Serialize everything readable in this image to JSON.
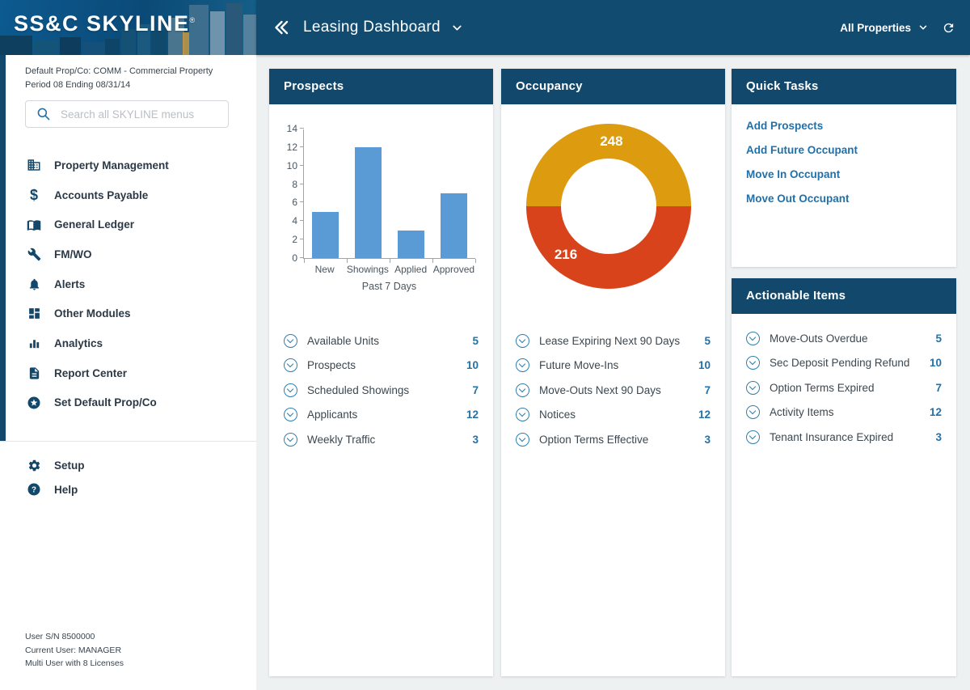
{
  "sidebar": {
    "logo_text": "SS&C SKYLINE",
    "logo_reg": "®",
    "default_prop_line1": "Default Prop/Co: COMM - Commercial Property",
    "default_prop_line2": "Period 08 Ending 08/31/14",
    "search_placeholder": "Search all SKYLINE menus",
    "menu": [
      {
        "label": "Property Management",
        "icon": "building-icon"
      },
      {
        "label": "Accounts Payable",
        "icon": "dollar-icon"
      },
      {
        "label": "General Ledger",
        "icon": "book-icon"
      },
      {
        "label": "FM/WO",
        "icon": "wrench-icon"
      },
      {
        "label": "Alerts",
        "icon": "bell-icon"
      },
      {
        "label": "Other Modules",
        "icon": "grid-icon"
      },
      {
        "label": "Analytics",
        "icon": "analytics-icon"
      },
      {
        "label": "Report Center",
        "icon": "report-icon"
      },
      {
        "label": "Set Default Prop/Co",
        "icon": "star-circle-icon"
      }
    ],
    "footer_menu": [
      {
        "label": "Setup",
        "icon": "gear-icon"
      },
      {
        "label": "Help",
        "icon": "question-icon"
      }
    ],
    "user_info": [
      "User S/N 8500000",
      "Current User: MANAGER",
      "Multi User with 8 Licenses"
    ]
  },
  "header": {
    "title": "Leasing Dashboard",
    "property_selector": "All Properties"
  },
  "cards": {
    "prospects": {
      "title": "Prospects",
      "list": [
        {
          "label": "Available Units",
          "count": "5"
        },
        {
          "label": "Prospects",
          "count": "10"
        },
        {
          "label": "Scheduled Showings",
          "count": "7"
        },
        {
          "label": "Applicants",
          "count": "12"
        },
        {
          "label": "Weekly Traffic",
          "count": "3"
        }
      ]
    },
    "occupancy": {
      "title": "Occupancy",
      "list": [
        {
          "label": "Lease Expiring Next 90 Days",
          "count": "5"
        },
        {
          "label": "Future Move-Ins",
          "count": "10"
        },
        {
          "label": "Move-Outs Next 90 Days",
          "count": "7"
        },
        {
          "label": "Notices",
          "count": "12"
        },
        {
          "label": "Option Terms Effective",
          "count": "3"
        }
      ]
    },
    "quick_tasks": {
      "title": "Quick Tasks",
      "links": [
        "Add Prospects",
        "Add Future Occupant",
        "Move In Occupant",
        "Move Out Occupant"
      ]
    },
    "actionable": {
      "title": "Actionable Items",
      "list": [
        {
          "label": "Move-Outs Overdue",
          "count": "5"
        },
        {
          "label": "Sec Deposit Pending Refund",
          "count": "10"
        },
        {
          "label": "Option Terms Expired",
          "count": "7"
        },
        {
          "label": "Activity Items",
          "count": "12"
        },
        {
          "label": "Tenant Insurance Expired",
          "count": "3"
        }
      ]
    }
  },
  "chart_data": [
    {
      "id": "prospects_past_7_days",
      "type": "bar",
      "categories": [
        "New",
        "Showings",
        "Applied",
        "Approved"
      ],
      "values": [
        5,
        12,
        3,
        7
      ],
      "title": "",
      "xlabel": "Past 7 Days",
      "ylabel": "",
      "ylim": [
        0,
        14
      ],
      "ytick_step": 2,
      "grid": false,
      "bar_color": "#5b9bd5"
    },
    {
      "id": "occupancy_donut",
      "type": "pie",
      "style": "donut",
      "values": [
        248,
        216
      ],
      "labels": [
        "248",
        "216"
      ],
      "colors": [
        "#dd9b10",
        "#d8431c"
      ],
      "legend": "none"
    }
  ],
  "colors": {
    "topbar_navy": "#114b70",
    "card_header_navy": "#12486b",
    "link_blue": "#2071a9",
    "count_blue": "#2272a8",
    "bar_blue": "#5b9bd5",
    "donut_amber": "#dd9b10",
    "donut_red": "#d8431c",
    "content_bg": "#eef1f2"
  }
}
